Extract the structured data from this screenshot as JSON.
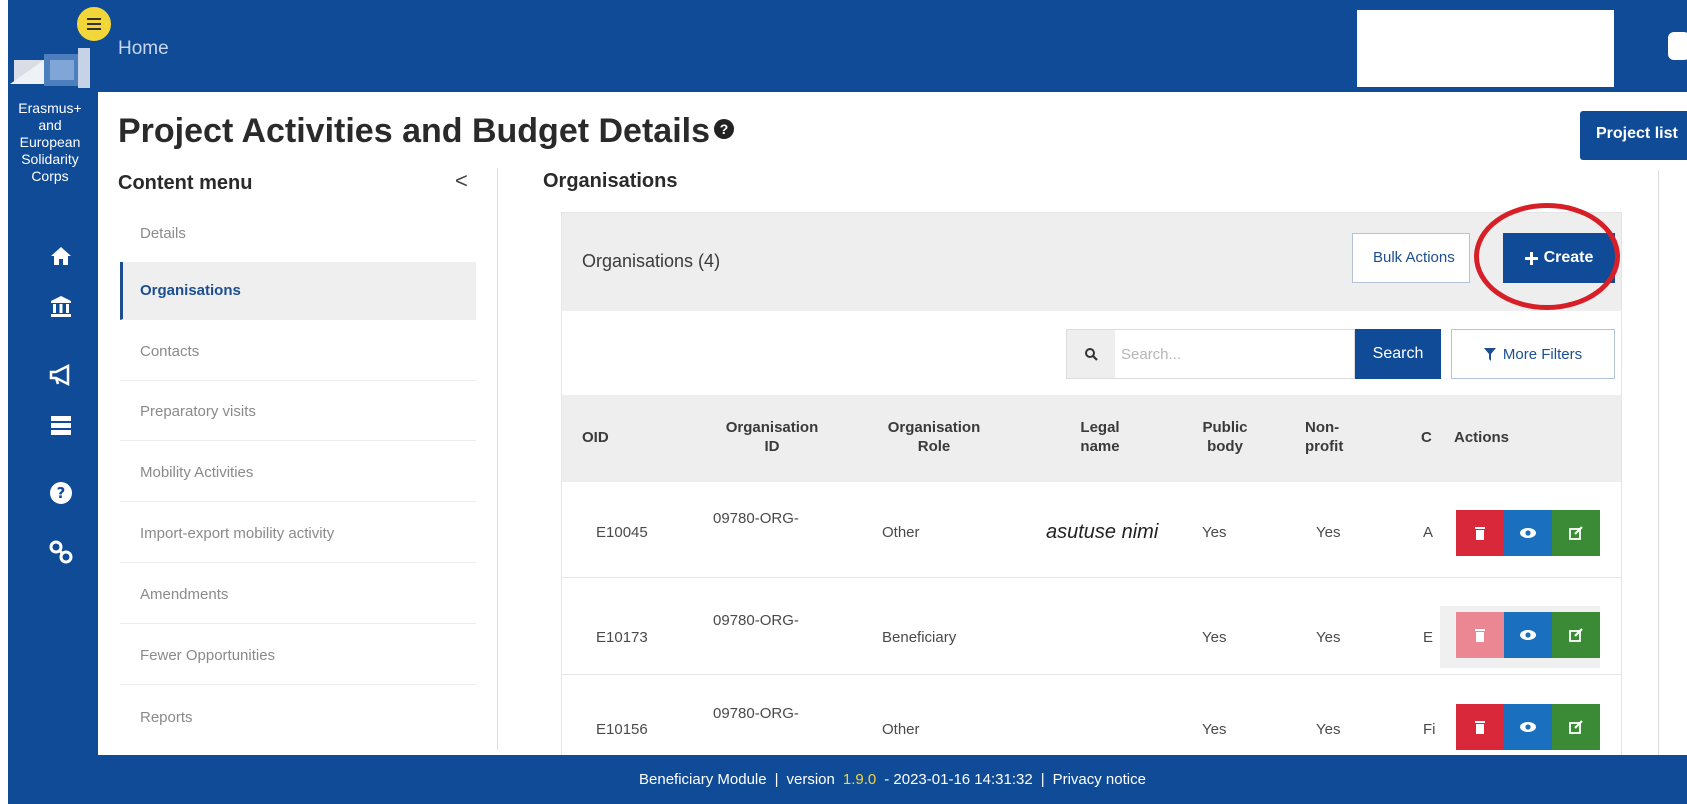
{
  "rail": {
    "title_lines": [
      "Erasmus+",
      "and",
      "European",
      "Solidarity",
      "Corps"
    ],
    "icons": [
      "home-icon",
      "institution-icon",
      "megaphone-icon",
      "list-icon",
      "help-icon",
      "link-icon"
    ]
  },
  "topbar": {
    "home_label": "Home"
  },
  "page": {
    "title": "Project Activities and Budget Details",
    "help_glyph": "?"
  },
  "project_list_button": "Project list",
  "content_menu": {
    "title": "Content menu",
    "collapse_glyph": "<",
    "items": [
      {
        "label": "Details",
        "active": false
      },
      {
        "label": "Organisations",
        "active": true
      },
      {
        "label": "Contacts",
        "active": false
      },
      {
        "label": "Preparatory visits",
        "active": false
      },
      {
        "label": "Mobility Activities",
        "active": false
      },
      {
        "label": "Import-export mobility activity",
        "active": false
      },
      {
        "label": "Amendments",
        "active": false
      },
      {
        "label": "Fewer Opportunities",
        "active": false
      },
      {
        "label": "Reports",
        "active": false
      }
    ]
  },
  "organisations": {
    "heading": "Organisations",
    "panel_title": "Organisations (4)",
    "bulk_actions_label": "Bulk Actions",
    "create_label": "Create",
    "search": {
      "placeholder": "Search...",
      "button_label": "Search"
    },
    "more_filters_label": "More Filters",
    "columns": [
      {
        "key": "oid",
        "lines": [
          "OID"
        ]
      },
      {
        "key": "org_id",
        "lines": [
          "Organisation",
          "ID"
        ]
      },
      {
        "key": "role",
        "lines": [
          "Organisation",
          "Role"
        ]
      },
      {
        "key": "legal",
        "lines": [
          "Legal",
          "name"
        ]
      },
      {
        "key": "public",
        "lines": [
          "Public",
          "body"
        ]
      },
      {
        "key": "nonprofit",
        "lines": [
          "Non-",
          "profit"
        ]
      },
      {
        "key": "c",
        "lines": [
          "C"
        ]
      },
      {
        "key": "actions",
        "lines": [
          "Actions"
        ]
      }
    ],
    "rows": [
      {
        "oid": "E10045",
        "org_id": "09780-ORG-",
        "role": "Other",
        "legal_note": "asutuse nimi",
        "public": "Yes",
        "nonprofit": "Yes",
        "c": "A",
        "delete_disabled": false
      },
      {
        "oid": "E10173",
        "org_id": "09780-ORG-",
        "role": "Beneficiary",
        "legal_note": "",
        "public": "Yes",
        "nonprofit": "Yes",
        "c": "E",
        "delete_disabled": true
      },
      {
        "oid": "E10156",
        "org_id": "09780-ORG-",
        "role": "Other",
        "legal_note": "",
        "public": "Yes",
        "nonprofit": "Yes",
        "c": "Fi",
        "delete_disabled": false
      }
    ]
  },
  "footer": {
    "module": "Beneficiary Module",
    "separator": "|",
    "version_prefix": "version",
    "version": "1.9.0",
    "build": "- 2023-01-16 14:31:32",
    "privacy": "Privacy notice"
  },
  "colors": {
    "brand_blue": "#0f4b96",
    "accent_yellow": "#f3d63a",
    "danger": "#d8283a",
    "view": "#1b6fbf",
    "edit": "#3a8a36",
    "highlight_circle": "#d61f26"
  }
}
